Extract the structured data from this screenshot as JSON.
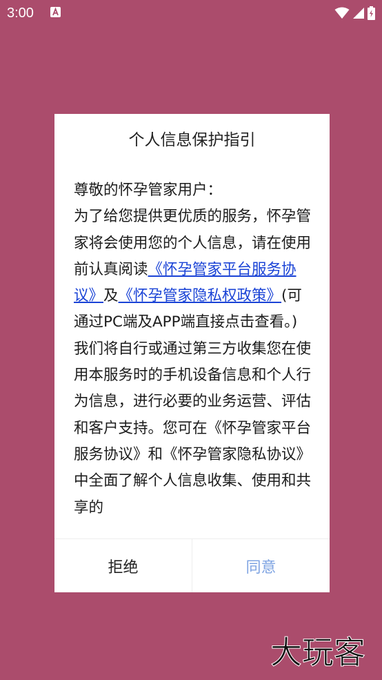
{
  "status_bar": {
    "time": "3:00"
  },
  "dialog": {
    "title": "个人信息保护指引",
    "greeting": "尊敬的怀孕管家用户：",
    "intro": "为了给您提供更优质的服务，怀孕管家将会使用您的个人信息，请在使用前认真阅读",
    "link_service": "《怀孕管家平台服务协议》",
    "and": "及",
    "link_privacy": "《怀孕管家隐私权政策》",
    "note": "(可通过PC端及APP端直接点击查看。)",
    "paragraph2": "我们将自行或通过第三方收集您在使用本服务时的手机设备信息和个人行为信息，进行必要的业务运营、评估和客户支持。您可在《怀孕管家平台服务协议》和《怀孕管家隐私协议》中全面了解个人信息收集、使用和共享的",
    "reject_label": "拒绝",
    "agree_label": "同意"
  },
  "watermark": {
    "text": "大玩客"
  },
  "colors": {
    "background": "#ab4c6c",
    "link": "#1a43d6",
    "agree": "#7fa4e2"
  }
}
